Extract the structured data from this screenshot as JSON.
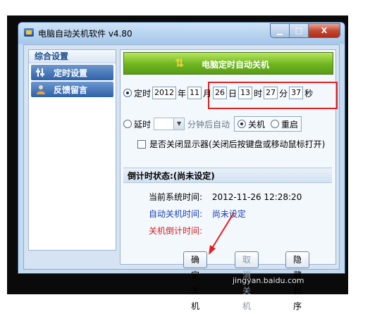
{
  "window": {
    "title": "电脑自动关机软件 v4.80",
    "minimize_glyph": "▁",
    "maximize_glyph": "□",
    "close_glyph": "X"
  },
  "sidebar": {
    "header": "综合设置",
    "items": [
      {
        "label": "定时设置",
        "icon": "tools-icon"
      },
      {
        "label": "反馈留言",
        "icon": "person-icon"
      }
    ]
  },
  "banner": {
    "title": "电脑定时自动关机",
    "icon": "up-down-arrows-icon"
  },
  "timed": {
    "label": "定时",
    "year": "2012",
    "year_unit": "年",
    "month": "11",
    "month_unit": "月",
    "day": "26",
    "day_unit": "日",
    "hour": "13",
    "hour_unit": "时",
    "minute": "27",
    "minute_unit": "分",
    "second": "37",
    "second_unit": "秒"
  },
  "delay": {
    "label": "延时",
    "combo_value": "",
    "suffix": "分钟后自动",
    "shutdown_label": "关机",
    "restart_label": "重启"
  },
  "monitor_option": "是否关闭显示器(关闭后按键盘或移动鼠标打开)",
  "status": {
    "title": "倒计时状态:(尚未设定)",
    "current_time_label": "当前系统时间:",
    "current_time_value": "2012-11-26 12:28:20",
    "auto_shutdown_label": "自动关机时间:",
    "auto_shutdown_value": "尚未设定",
    "countdown_label": "关机倒计时间:"
  },
  "buttons": {
    "confirm": "确定关机",
    "cancel": "取消关机",
    "hide": "隐藏程序"
  },
  "watermark": "jingyan.baidu.com",
  "colors": {
    "accent": "#2f62a8",
    "banner_green": "#6eb521",
    "highlight": "#e02020",
    "alert_text": "#d32020",
    "link_text": "#1a3fb3"
  }
}
